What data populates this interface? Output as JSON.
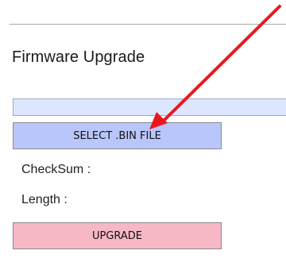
{
  "section": {
    "title": "Firmware Upgrade"
  },
  "file_input": {
    "value": ""
  },
  "buttons": {
    "select_file": "SELECT .BIN FILE",
    "upgrade": "UPGRADE"
  },
  "info": {
    "checksum_label": "CheckSum :",
    "length_label": "Length :"
  },
  "colors": {
    "select_button_bg": "#b9c6fb",
    "upgrade_button_bg": "#f7b8c6",
    "file_field_bg": "#dde6ff",
    "annotation_arrow": "#e8191d"
  }
}
